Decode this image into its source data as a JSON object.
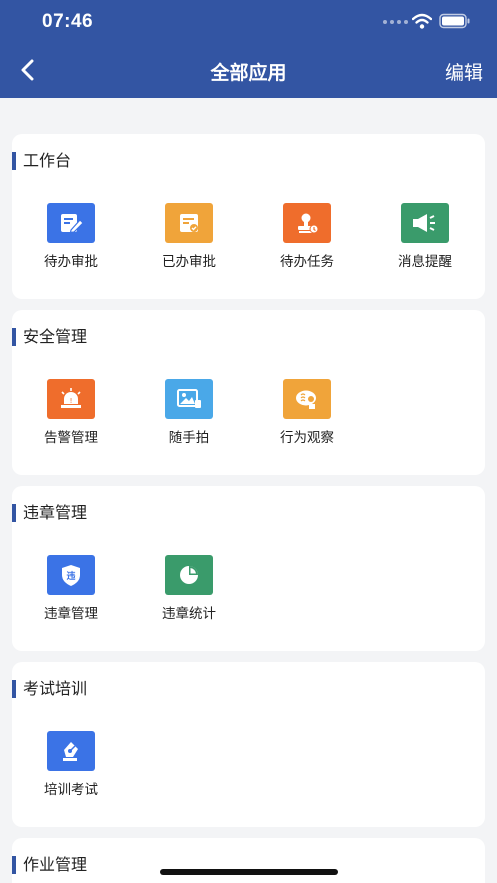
{
  "status_bar": {
    "time": "07:46"
  },
  "header": {
    "title": "全部应用",
    "edit_label": "编辑"
  },
  "sections": [
    {
      "title": "工作台",
      "apps": [
        {
          "label": "待办审批",
          "icon": "edit-document-icon",
          "color": "#3b73e6"
        },
        {
          "label": "已办审批",
          "icon": "document-check-icon",
          "color": "#f0a43a"
        },
        {
          "label": "待办任务",
          "icon": "stamp-icon",
          "color": "#ef6d2c"
        },
        {
          "label": "消息提醒",
          "icon": "megaphone-icon",
          "color": "#3a9b6b"
        }
      ]
    },
    {
      "title": "安全管理",
      "apps": [
        {
          "label": "告警管理",
          "icon": "alarm-light-icon",
          "color": "#ef6d2c"
        },
        {
          "label": "随手拍",
          "icon": "photo-icon",
          "color": "#4aa8e8"
        },
        {
          "label": "行为观察",
          "icon": "observe-icon",
          "color": "#f0a43a"
        }
      ]
    },
    {
      "title": "违章管理",
      "apps": [
        {
          "label": "违章管理",
          "icon": "violation-shield-icon",
          "color": "#3b73e6"
        },
        {
          "label": "违章统计",
          "icon": "pie-chart-icon",
          "color": "#3a9b6b"
        }
      ]
    },
    {
      "title": "考试培训",
      "apps": [
        {
          "label": "培训考试",
          "icon": "pen-nib-icon",
          "color": "#3b73e6"
        }
      ]
    },
    {
      "title": "作业管理",
      "apps": []
    }
  ]
}
